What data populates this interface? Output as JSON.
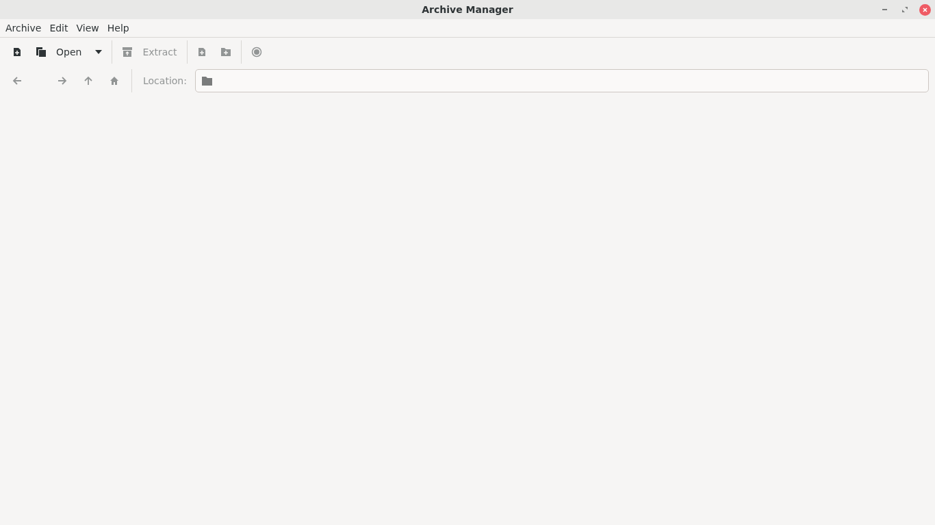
{
  "window": {
    "title": "Archive Manager"
  },
  "menu": [
    {
      "label": "Archive"
    },
    {
      "label": "Edit"
    },
    {
      "label": "View"
    },
    {
      "label": "Help"
    }
  ],
  "toolbar": [
    {
      "kind": "new",
      "disabled": false
    },
    {
      "kind": "open",
      "label": "Open",
      "disabled": false
    },
    {
      "kind": "extract",
      "label": "Extract",
      "disabled": true
    },
    {
      "kind": "add-file",
      "disabled": true
    },
    {
      "kind": "add-folder",
      "disabled": true
    },
    {
      "kind": "stop",
      "disabled": true
    }
  ],
  "navigation": [
    {
      "kind": "back",
      "disabled": true
    },
    {
      "kind": "forward",
      "disabled": true
    },
    {
      "kind": "up",
      "disabled": true
    },
    {
      "kind": "home",
      "disabled": true
    }
  ],
  "location": {
    "label": "Location:"
  }
}
